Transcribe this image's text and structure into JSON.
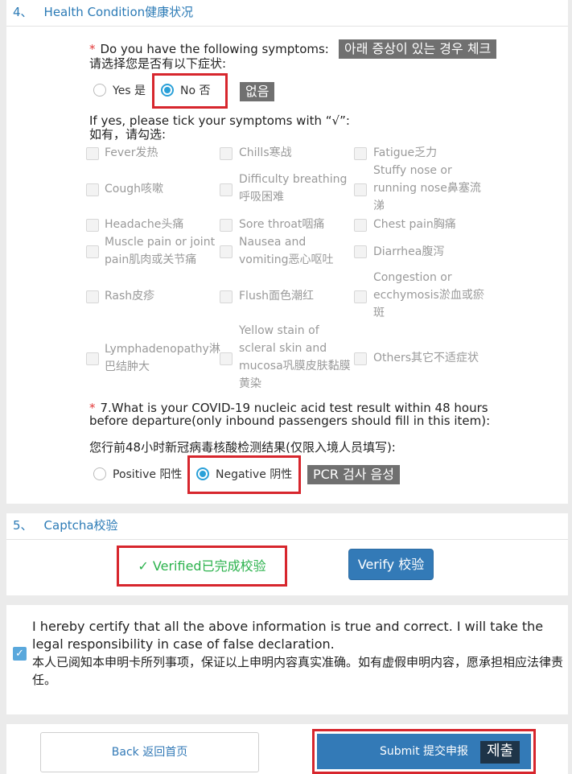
{
  "section4": {
    "number": "4、",
    "title": "Health Condition健康状况",
    "q_symptoms": {
      "required_mark": "*",
      "text_en": "Do you have the following symptoms:",
      "text_zh": "请选择您是否有以下症状:",
      "annotation": "아래 증상이 있는 경우 체크",
      "options": [
        {
          "label": "Yes 是",
          "selected": false
        },
        {
          "label": "No 否",
          "selected": true
        }
      ],
      "selected_annotation": "없음"
    },
    "tick_prompt_en": "If yes, please tick your symptoms with “√”:",
    "tick_prompt_zh": "如有，请勾选:",
    "symptoms": {
      "fever": "Fever发热",
      "chills": "Chills寒战",
      "fatigue": "Fatigue乏力",
      "cough": "Cough咳嗽",
      "difficulty_breathing": "Difficulty breathing呼吸困难",
      "stuffy_nose": "Stuffy nose or running nose鼻塞流涕",
      "headache": "Headache头痛",
      "sore_throat": "Sore throat咽痛",
      "chest_pain": "Chest pain胸痛",
      "muscle_pain": "Muscle pain or joint pain肌肉或关节痛",
      "nausea": "Nausea and vomiting恶心呕吐",
      "diarrhea": "Diarrhea腹泻",
      "rash": "Rash皮疹",
      "flush": "Flush面色潮红",
      "congestion": "Congestion or ecchymosis淤血或瘀斑",
      "lymphadenopathy": "Lymphadenopathy淋巴结肿大",
      "yellow_stain": "Yellow stain of scleral skin and mucosa巩膜皮肤黏膜黄染",
      "others": "Others其它不适症状"
    },
    "q_pcr": {
      "required_mark": "*",
      "text_en": "7.What is your COVID-19 nucleic acid test result within 48 hours before departure(only inbound passengers should fill in this item):",
      "text_zh": "您行前48小时新冠病毒核酸检测结果(仅限入境人员填写):",
      "options": [
        {
          "label": "Positive 阳性",
          "selected": false
        },
        {
          "label": "Negative 阴性",
          "selected": true
        }
      ],
      "selected_annotation": "PCR 검사 음성"
    }
  },
  "section5": {
    "number": "5、",
    "title": "Captcha校验",
    "verified_text": "✓ Verified已完成校验",
    "verify_button": "Verify 校验"
  },
  "certification": {
    "checked": true,
    "check_glyph": "✓",
    "text_en": "I hereby certify that all the above information is true and correct. I will take the legal responsibility in case of false declaration.",
    "text_zh": "本人已阅知本申明卡所列事项，保证以上申明内容真实准确。如有虚假申明内容，愿承担相应法律责任。"
  },
  "actions": {
    "back_label": "Back 返回首页",
    "submit_label": "Submit 提交申报",
    "submit_annotation": "제출"
  },
  "colors": {
    "accent": "#337ab7",
    "header_text": "#2c7bb6",
    "highlight_box": "#d7262d",
    "verified_text": "#2bb24c",
    "annotation_bg": "#707070"
  }
}
